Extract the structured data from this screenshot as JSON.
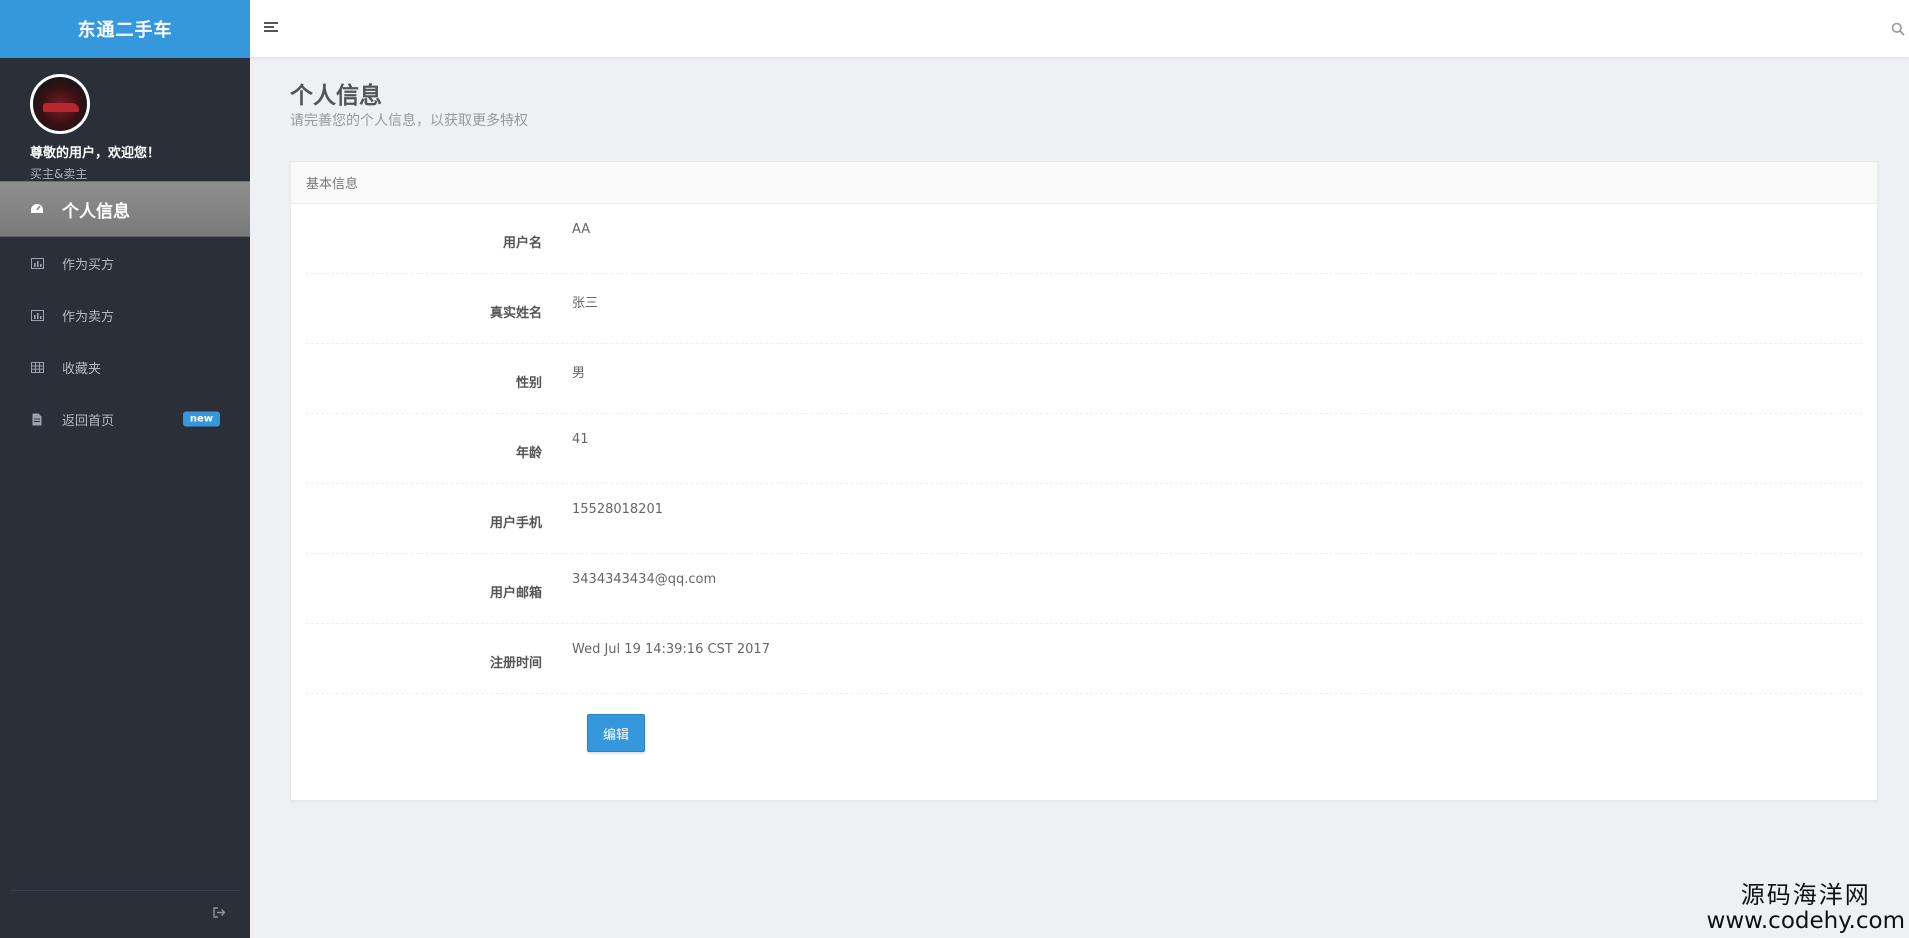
{
  "brand": {
    "title": "东通二手车"
  },
  "user": {
    "welcome": "尊敬的用户，欢迎您！",
    "role": "买主&卖主"
  },
  "sidebar": {
    "items": [
      {
        "label": "个人信息",
        "icon": "dashboard-icon",
        "active": true
      },
      {
        "label": "作为买方",
        "icon": "bar-chart-icon"
      },
      {
        "label": "作为卖方",
        "icon": "bar-chart-icon"
      },
      {
        "label": "收藏夹",
        "icon": "grid-icon"
      },
      {
        "label": "返回首页",
        "icon": "document-icon",
        "badge": "new"
      }
    ]
  },
  "page": {
    "title": "个人信息",
    "subtitle": "请完善您的个人信息，以获取更多特权"
  },
  "card": {
    "header": "基本信息",
    "fields": [
      {
        "label": "用户名",
        "value": "AA"
      },
      {
        "label": "真实姓名",
        "value": "张三"
      },
      {
        "label": "性别",
        "value": "男"
      },
      {
        "label": "年龄",
        "value": "41"
      },
      {
        "label": "用户手机",
        "value": "15528018201"
      },
      {
        "label": "用户邮箱",
        "value": "3434343434@qq.com"
      },
      {
        "label": "注册时间",
        "value": "Wed Jul 19 14:39:16 CST 2017"
      }
    ],
    "edit_label": "编辑"
  },
  "colors": {
    "accent": "#3598dc",
    "sidebar_bg": "#2b3038",
    "background": "#eef0f3"
  },
  "watermark": {
    "line1": "源码海洋网",
    "line2": "www.codehy.com"
  }
}
